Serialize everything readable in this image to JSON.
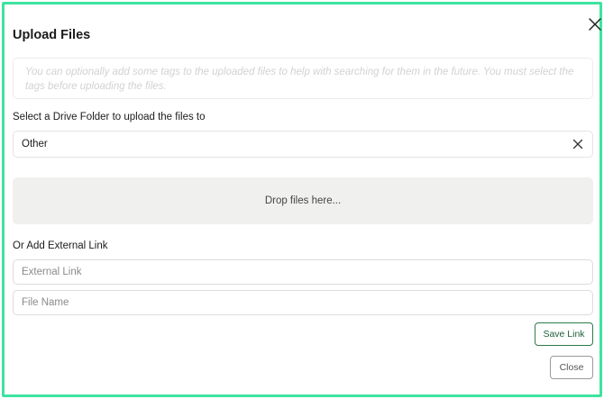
{
  "dialog": {
    "title": "Upload Files",
    "tags_placeholder": "You can optionally add some tags to the uploaded files to help with searching for them in the future. You must select the tags before uploading the files.",
    "folder_label": "Select a Drive Folder to upload the files to",
    "folder_value": "Other",
    "dropzone_text": "Drop files here...",
    "external_label": "Or Add External Link",
    "external_link_placeholder": "External Link",
    "file_name_placeholder": "File Name",
    "save_link_label": "Save Link",
    "close_label": "Close"
  },
  "icons": {
    "dialog_close": "close-icon",
    "folder_clear": "clear-icon"
  },
  "colors": {
    "frame_border": "#3ee3a0",
    "save_border": "#2f7a4b",
    "dropzone_bg": "#f0f0ef"
  }
}
